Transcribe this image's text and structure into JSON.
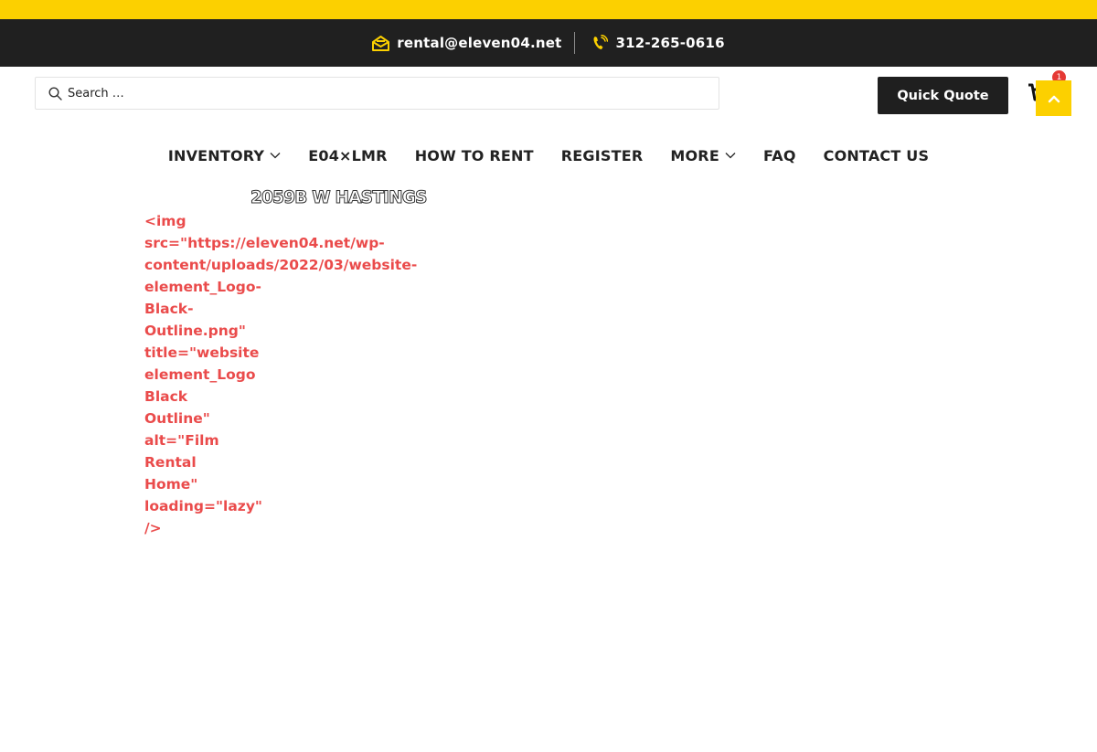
{
  "topbar": {
    "email": "rental@eleven04.net",
    "phone": "312-265-0616"
  },
  "search": {
    "placeholder": "Search …"
  },
  "header": {
    "quote_label": "Quick Quote",
    "cart_count": "1"
  },
  "nav": {
    "items": [
      {
        "label": "INVENTORY",
        "dropdown": true
      },
      {
        "label": "E04×LMR",
        "dropdown": false
      },
      {
        "label": "HOW TO RENT",
        "dropdown": false
      },
      {
        "label": "REGISTER",
        "dropdown": false
      },
      {
        "label": "MORE",
        "dropdown": true
      },
      {
        "label": "FAQ",
        "dropdown": false
      },
      {
        "label": "CONTACT US",
        "dropdown": false
      }
    ]
  },
  "content": {
    "address": "2059B W HASTINGS",
    "code_lines": [
      "<img",
      "src=\"https://eleven04.net/wp-",
      "content/uploads/2022/03/website-",
      "element_Logo-",
      "Black-",
      "Outline.png\"",
      "title=\"website",
      "element_Logo",
      "Black",
      "Outline\"",
      "alt=\"Film",
      "Rental",
      "Home\"",
      "loading=\"lazy\"",
      "/>"
    ]
  },
  "colors": {
    "accent": "#fcd000",
    "dark": "#202020",
    "code_red": "#ea4b4b",
    "badge": "#e53935"
  },
  "icons": {
    "email": "envelope-open-icon",
    "phone": "phone-ringing-icon",
    "search": "search-icon",
    "cart": "cart-icon",
    "scroll_top": "chevron-up-icon",
    "dropdown": "chevron-down-icon"
  }
}
